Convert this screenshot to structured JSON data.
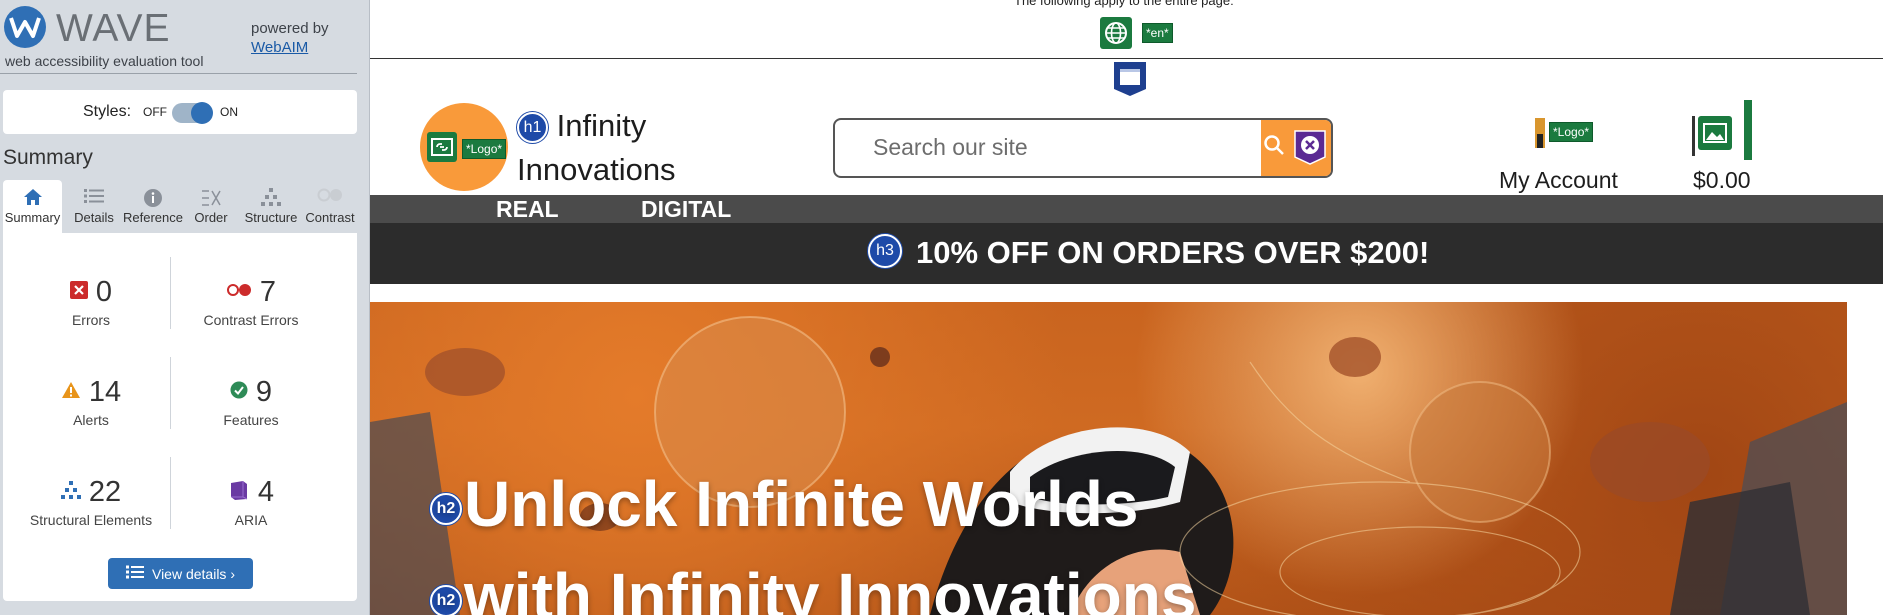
{
  "wave": {
    "brand": "WAVE",
    "tagline": "web accessibility evaluation tool",
    "powered_by": "powered by",
    "webaim_link": "WebAIM",
    "styles_label": "Styles:",
    "styles_off": "OFF",
    "styles_on": "ON",
    "styles_state": "on",
    "summary_title": "Summary",
    "tabs": [
      {
        "label": "Summary",
        "icon": "home-icon",
        "active": true
      },
      {
        "label": "Details",
        "icon": "list-icon"
      },
      {
        "label": "Reference",
        "icon": "info-icon"
      },
      {
        "label": "Order",
        "icon": "order-icon"
      },
      {
        "label": "Structure",
        "icon": "structure-icon"
      },
      {
        "label": "Contrast",
        "icon": "contrast-icon"
      }
    ],
    "stats": {
      "errors": {
        "count": "0",
        "label": "Errors"
      },
      "contrast_errors": {
        "count": "7",
        "label": "Contrast Errors"
      },
      "alerts": {
        "count": "14",
        "label": "Alerts"
      },
      "features": {
        "count": "9",
        "label": "Features"
      },
      "structural": {
        "count": "22",
        "label": "Structural Elements"
      },
      "aria": {
        "count": "4",
        "label": "ARIA"
      }
    },
    "view_details": "View details ›",
    "colors": {
      "accent": "#2f6fb5",
      "error": "#cc2b2b",
      "alert": "#e8941a",
      "feature": "#2e8b57",
      "aria": "#6a3aa3"
    }
  },
  "page": {
    "apply_text": "The following apply to the entire page:",
    "lang_tag": "*en*",
    "logo_alt": "*Logo*",
    "h1_badge": "h1",
    "site_title_line1": "Infinity",
    "site_title_line2": "Innovations",
    "search_placeholder": "Search our site",
    "account_logo_alt": "*Logo*",
    "account_label": "My Account",
    "cart_total": "$0.00",
    "nav": [
      "REAL",
      "DIGITAL"
    ],
    "h3_badge": "h3",
    "promo": "10% OFF ON ORDERS OVER $200!",
    "h2_badge": "h2",
    "hero_line1": "Unlock Infinite Worlds",
    "hero_line2": "with Infinity Innovations"
  }
}
